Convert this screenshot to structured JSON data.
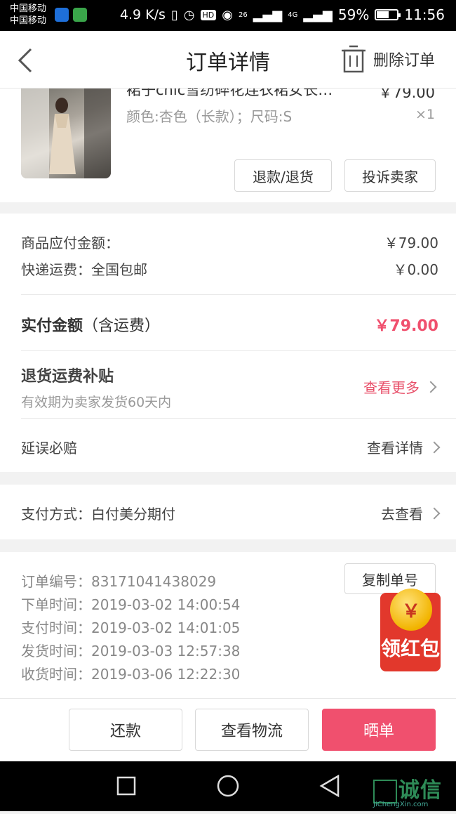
{
  "status_bar": {
    "carrier_1": "中国移动",
    "carrier_2": "中国移动",
    "speed": "4.9 K/s",
    "net_1": "26",
    "net_2": "4G",
    "battery": "59%",
    "battery_level": 0.59,
    "time": "11:56",
    "hd": "HD"
  },
  "nav": {
    "title": "订单详情",
    "delete_label": "删除订单"
  },
  "product": {
    "name": "裙子chic雪纺碎花连衣裙女长…",
    "price": "￥79.00",
    "spec": "颜色:杏色（长款）；尺码:S",
    "qty": "×1",
    "refund_button": "退款/退货",
    "complain_button": "投诉卖家"
  },
  "amounts": {
    "goods_label": "商品应付金额：",
    "goods_value": "￥79.00",
    "shipping_label": "快递运费：全国包邮",
    "shipping_value": "￥0.00",
    "paid_label": "实付金额",
    "paid_note": "（含运费）",
    "paid_value": "￥79.00"
  },
  "subsidy": {
    "title": "退货运费补贴",
    "desc": "有效期为卖家发货60天内",
    "link": "查看更多"
  },
  "delay": {
    "title": "延误必赔",
    "link": "查看详情"
  },
  "payment": {
    "label": "支付方式：白付美分期付",
    "link": "去查看"
  },
  "order_info": {
    "copy_button": "复制单号",
    "lines": [
      "订单编号：83171041438029",
      "下单时间：2019-03-02  14:00:54",
      "支付时间：2019-03-02  14:01:05",
      "发货时间：2019-03-03  12:57:38",
      "收货时间：2019-03-06  12:22:30"
    ]
  },
  "red_packet": {
    "coin": "￥",
    "label": "领红包"
  },
  "bottom_actions": {
    "repay": "还款",
    "logistics": "查看物流",
    "share": "晒单"
  },
  "watermark": {
    "main": "诚信",
    "sub": "JiChengXin.com"
  },
  "colors": {
    "accent": "#f0506e",
    "price_red": "#f0506e",
    "link_red": "#e8506a"
  }
}
